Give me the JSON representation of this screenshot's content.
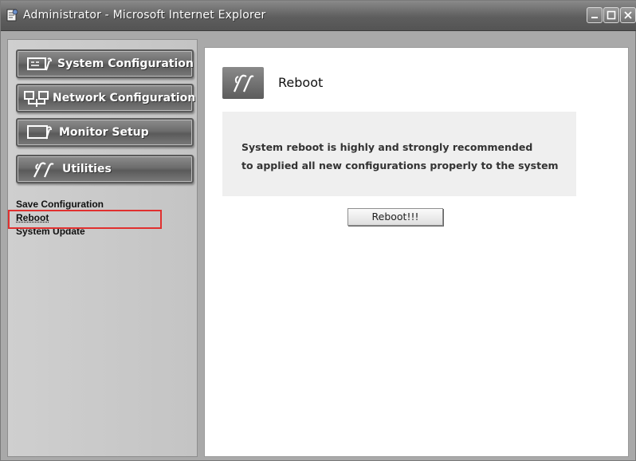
{
  "window": {
    "title": "Administrator - Microsoft Internet Explorer",
    "icons": [
      "ie-page-icon",
      "minimize-icon",
      "maximize-icon",
      "close-icon"
    ]
  },
  "sidebar": {
    "nav": [
      {
        "label": "System Configuration",
        "icon": "monitor-wrench-icon"
      },
      {
        "label": "Network Configuration",
        "icon": "network-computers-icon"
      },
      {
        "label": "Monitor Setup",
        "icon": "monitor-wrench-icon"
      },
      {
        "label": "Utilities",
        "icon": "tools-icon"
      }
    ],
    "submenu": [
      {
        "label": "Save Configuration"
      },
      {
        "label": "Reboot",
        "active": true
      },
      {
        "label": "System Update"
      }
    ],
    "highlight_color": "#e0302f"
  },
  "main": {
    "title": "Reboot",
    "icon": "tools-icon",
    "message_line1": "System reboot is highly and strongly recommended",
    "message_line2": "to applied all new configurations properly to the system",
    "button_label": "Reboot!!!"
  }
}
